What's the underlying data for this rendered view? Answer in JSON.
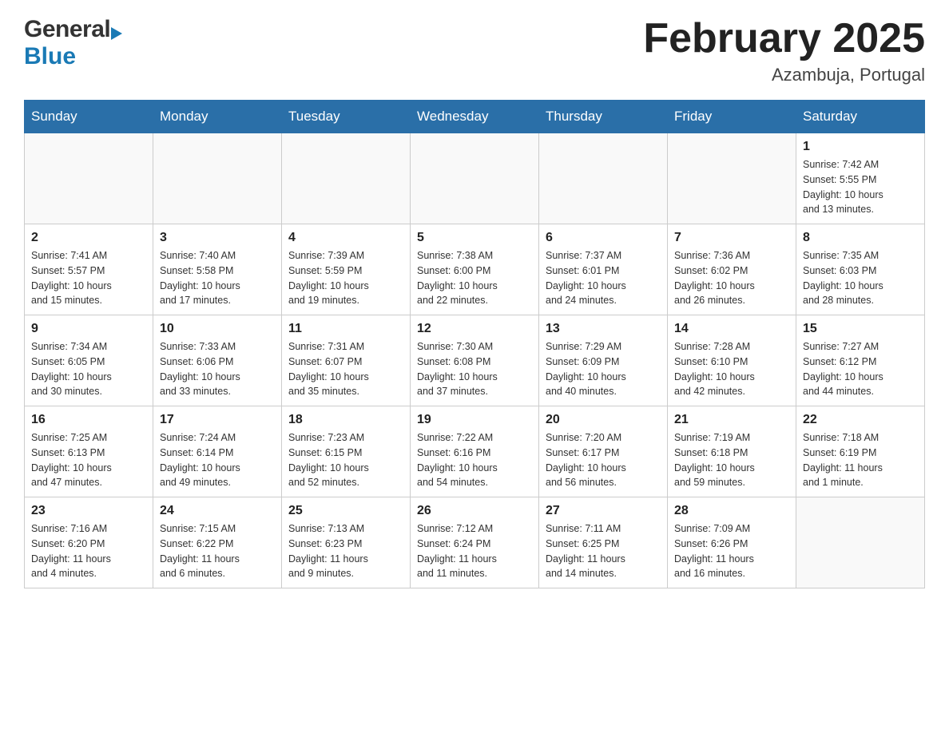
{
  "header": {
    "logo_general": "General",
    "logo_blue": "Blue",
    "title": "February 2025",
    "subtitle": "Azambuja, Portugal"
  },
  "weekdays": [
    "Sunday",
    "Monday",
    "Tuesday",
    "Wednesday",
    "Thursday",
    "Friday",
    "Saturday"
  ],
  "weeks": [
    [
      {
        "day": "",
        "info": ""
      },
      {
        "day": "",
        "info": ""
      },
      {
        "day": "",
        "info": ""
      },
      {
        "day": "",
        "info": ""
      },
      {
        "day": "",
        "info": ""
      },
      {
        "day": "",
        "info": ""
      },
      {
        "day": "1",
        "info": "Sunrise: 7:42 AM\nSunset: 5:55 PM\nDaylight: 10 hours\nand 13 minutes."
      }
    ],
    [
      {
        "day": "2",
        "info": "Sunrise: 7:41 AM\nSunset: 5:57 PM\nDaylight: 10 hours\nand 15 minutes."
      },
      {
        "day": "3",
        "info": "Sunrise: 7:40 AM\nSunset: 5:58 PM\nDaylight: 10 hours\nand 17 minutes."
      },
      {
        "day": "4",
        "info": "Sunrise: 7:39 AM\nSunset: 5:59 PM\nDaylight: 10 hours\nand 19 minutes."
      },
      {
        "day": "5",
        "info": "Sunrise: 7:38 AM\nSunset: 6:00 PM\nDaylight: 10 hours\nand 22 minutes."
      },
      {
        "day": "6",
        "info": "Sunrise: 7:37 AM\nSunset: 6:01 PM\nDaylight: 10 hours\nand 24 minutes."
      },
      {
        "day": "7",
        "info": "Sunrise: 7:36 AM\nSunset: 6:02 PM\nDaylight: 10 hours\nand 26 minutes."
      },
      {
        "day": "8",
        "info": "Sunrise: 7:35 AM\nSunset: 6:03 PM\nDaylight: 10 hours\nand 28 minutes."
      }
    ],
    [
      {
        "day": "9",
        "info": "Sunrise: 7:34 AM\nSunset: 6:05 PM\nDaylight: 10 hours\nand 30 minutes."
      },
      {
        "day": "10",
        "info": "Sunrise: 7:33 AM\nSunset: 6:06 PM\nDaylight: 10 hours\nand 33 minutes."
      },
      {
        "day": "11",
        "info": "Sunrise: 7:31 AM\nSunset: 6:07 PM\nDaylight: 10 hours\nand 35 minutes."
      },
      {
        "day": "12",
        "info": "Sunrise: 7:30 AM\nSunset: 6:08 PM\nDaylight: 10 hours\nand 37 minutes."
      },
      {
        "day": "13",
        "info": "Sunrise: 7:29 AM\nSunset: 6:09 PM\nDaylight: 10 hours\nand 40 minutes."
      },
      {
        "day": "14",
        "info": "Sunrise: 7:28 AM\nSunset: 6:10 PM\nDaylight: 10 hours\nand 42 minutes."
      },
      {
        "day": "15",
        "info": "Sunrise: 7:27 AM\nSunset: 6:12 PM\nDaylight: 10 hours\nand 44 minutes."
      }
    ],
    [
      {
        "day": "16",
        "info": "Sunrise: 7:25 AM\nSunset: 6:13 PM\nDaylight: 10 hours\nand 47 minutes."
      },
      {
        "day": "17",
        "info": "Sunrise: 7:24 AM\nSunset: 6:14 PM\nDaylight: 10 hours\nand 49 minutes."
      },
      {
        "day": "18",
        "info": "Sunrise: 7:23 AM\nSunset: 6:15 PM\nDaylight: 10 hours\nand 52 minutes."
      },
      {
        "day": "19",
        "info": "Sunrise: 7:22 AM\nSunset: 6:16 PM\nDaylight: 10 hours\nand 54 minutes."
      },
      {
        "day": "20",
        "info": "Sunrise: 7:20 AM\nSunset: 6:17 PM\nDaylight: 10 hours\nand 56 minutes."
      },
      {
        "day": "21",
        "info": "Sunrise: 7:19 AM\nSunset: 6:18 PM\nDaylight: 10 hours\nand 59 minutes."
      },
      {
        "day": "22",
        "info": "Sunrise: 7:18 AM\nSunset: 6:19 PM\nDaylight: 11 hours\nand 1 minute."
      }
    ],
    [
      {
        "day": "23",
        "info": "Sunrise: 7:16 AM\nSunset: 6:20 PM\nDaylight: 11 hours\nand 4 minutes."
      },
      {
        "day": "24",
        "info": "Sunrise: 7:15 AM\nSunset: 6:22 PM\nDaylight: 11 hours\nand 6 minutes."
      },
      {
        "day": "25",
        "info": "Sunrise: 7:13 AM\nSunset: 6:23 PM\nDaylight: 11 hours\nand 9 minutes."
      },
      {
        "day": "26",
        "info": "Sunrise: 7:12 AM\nSunset: 6:24 PM\nDaylight: 11 hours\nand 11 minutes."
      },
      {
        "day": "27",
        "info": "Sunrise: 7:11 AM\nSunset: 6:25 PM\nDaylight: 11 hours\nand 14 minutes."
      },
      {
        "day": "28",
        "info": "Sunrise: 7:09 AM\nSunset: 6:26 PM\nDaylight: 11 hours\nand 16 minutes."
      },
      {
        "day": "",
        "info": ""
      }
    ]
  ]
}
